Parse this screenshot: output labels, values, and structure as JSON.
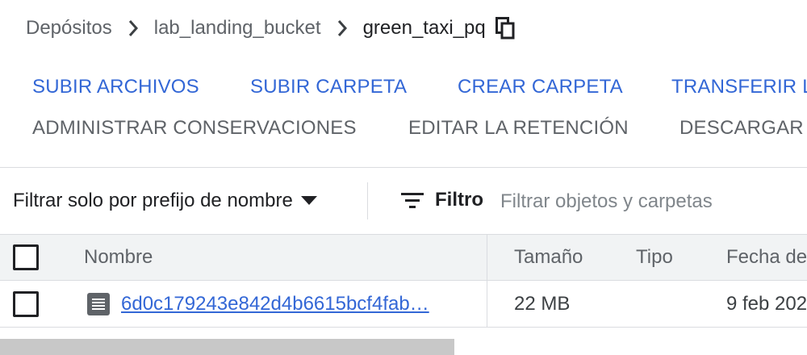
{
  "breadcrumb": {
    "items": [
      "Depósitos",
      "lab_landing_bucket",
      "green_taxi_pq"
    ]
  },
  "actions": {
    "row1": [
      "SUBIR ARCHIVOS",
      "SUBIR CARPETA",
      "CREAR CARPETA",
      "TRANSFERIR L"
    ],
    "row2": [
      "ADMINISTRAR CONSERVACIONES",
      "EDITAR LA RETENCIÓN",
      "DESCARGAR"
    ]
  },
  "filter": {
    "prefix_label": "Filtrar solo por prefijo de nombre",
    "label": "Filtro",
    "placeholder": "Filtrar objetos y carpetas"
  },
  "table": {
    "headers": [
      "Nombre",
      "Tamaño",
      "Tipo",
      "Fecha de"
    ],
    "rows": [
      {
        "name": "6d0c179243e842d4b6615bcf4fab…",
        "size": "22 MB",
        "type": "",
        "date": "9 feb 202"
      }
    ]
  },
  "icons": {
    "copy": "copy-icon",
    "chevron": "chevron-right-icon",
    "caret": "caret-down-icon",
    "filter": "filter-icon",
    "file": "file-icon"
  },
  "colors": {
    "primary": "#3367d6",
    "secondary_text": "#5f6368",
    "header_bg": "#f1f3f4",
    "border": "#dadce0"
  }
}
